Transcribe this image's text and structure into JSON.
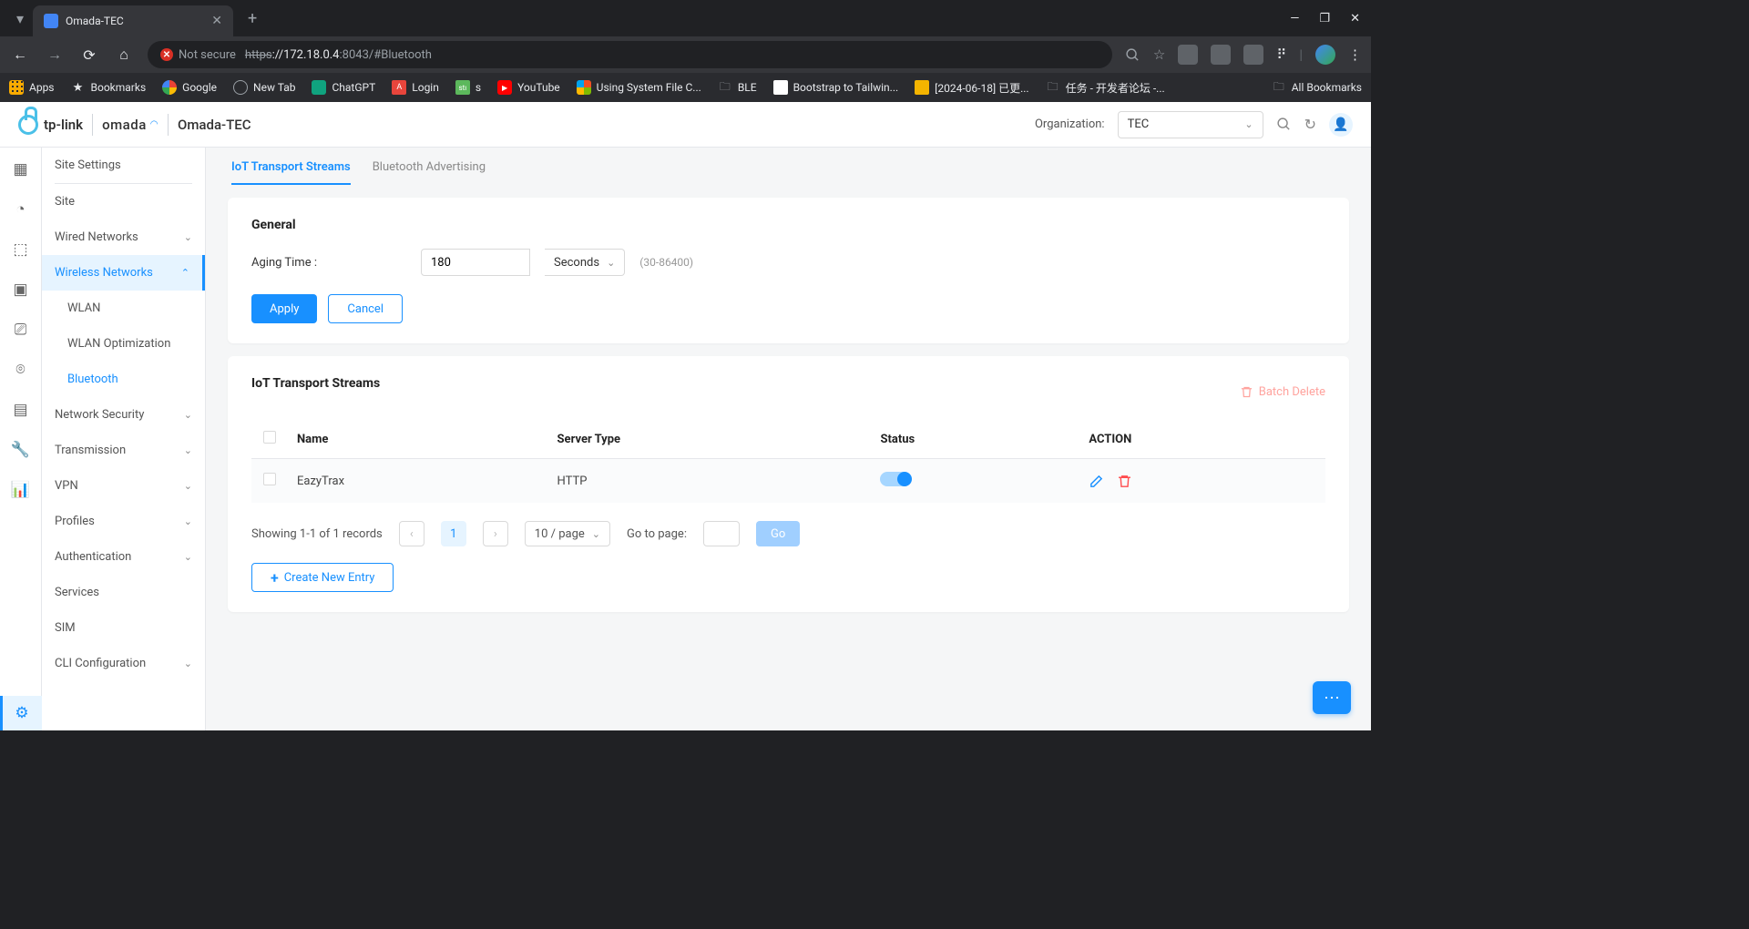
{
  "browser": {
    "tab_title": "Omada-TEC",
    "url_warn": "Not secure",
    "url_protocol": "https",
    "url_host": "://172.18.0.4",
    "url_path": ":8043/#Bluetooth",
    "bookmarks": {
      "apps": "Apps",
      "bookmarks": "Bookmarks",
      "google": "Google",
      "newtab": "New Tab",
      "chatgpt": "ChatGPT",
      "login": "Login",
      "s": "s",
      "youtube": "YouTube",
      "using": "Using System File C...",
      "ble": "BLE",
      "bootstrap": "Bootstrap to Tailwin...",
      "date": "[2024-06-18] 已更...",
      "task": "任务 - 开发者论坛 -...",
      "all": "All Bookmarks"
    }
  },
  "header": {
    "brand1": "tp-link",
    "brand2": "omada",
    "site": "Omada-TEC",
    "org_label": "Organization:",
    "org_value": "TEC"
  },
  "sidebar": {
    "site_settings": "Site Settings",
    "site": "Site",
    "wired": "Wired Networks",
    "wireless": "Wireless Networks",
    "wlan": "WLAN",
    "wlan_opt": "WLAN Optimization",
    "bluetooth": "Bluetooth",
    "netsec": "Network Security",
    "transmission": "Transmission",
    "vpn": "VPN",
    "profiles": "Profiles",
    "auth": "Authentication",
    "services": "Services",
    "sim": "SIM",
    "cli": "CLI Configuration"
  },
  "tabs": {
    "iot": "IoT Transport Streams",
    "bt_adv": "Bluetooth Advertising"
  },
  "general": {
    "title": "General",
    "aging_label": "Aging Time :",
    "aging_value": "180",
    "aging_unit": "Seconds",
    "aging_hint": "(30-86400)",
    "apply": "Apply",
    "cancel": "Cancel"
  },
  "streams": {
    "title": "IoT Transport Streams",
    "batch_delete": "Batch Delete",
    "cols": {
      "name": "Name",
      "server": "Server Type",
      "status": "Status",
      "action": "ACTION"
    },
    "rows": [
      {
        "name": "EazyTrax",
        "server": "HTTP",
        "status": true
      }
    ],
    "showing": "Showing 1-1 of 1 records",
    "page_size": "10 / page",
    "goto_label": "Go to page:",
    "go": "Go",
    "create": "Create New Entry",
    "current_page": "1"
  }
}
